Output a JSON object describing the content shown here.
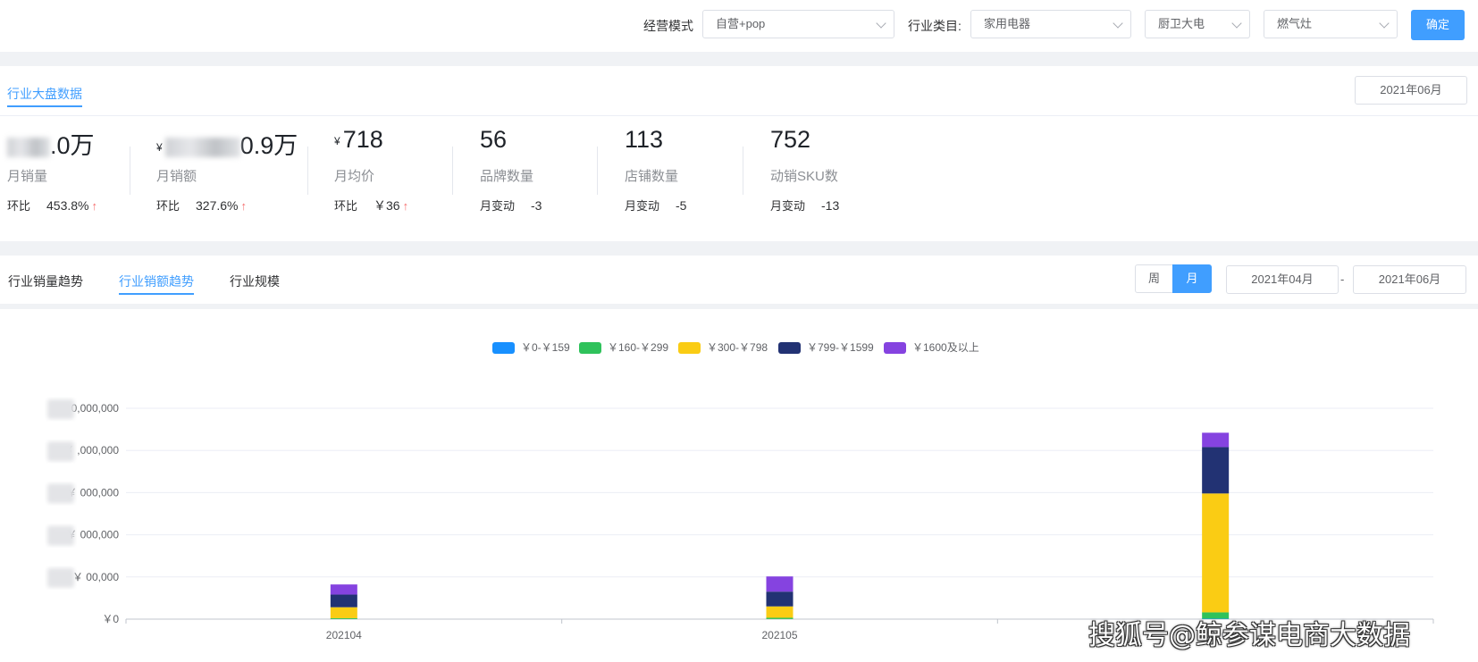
{
  "filters": {
    "mode_label": "经营模式",
    "mode_value": "自营+pop",
    "category_label": "行业类目:",
    "category_value": "家用电器",
    "subcategory_value": "厨卫大电",
    "subsubcategory_value": "燃气灶",
    "confirm_label": "确定"
  },
  "overview": {
    "tab_label": "行业大盘数据",
    "date": "2021年06月",
    "stats": [
      {
        "value": ".0万",
        "label": "月销量",
        "sub_label": "环比",
        "sub_value": "453.8%",
        "trend": "up"
      },
      {
        "yen": "¥",
        "value": "0.9万",
        "label": "月销额",
        "sub_label": "环比",
        "sub_value": "327.6%",
        "trend": "up"
      },
      {
        "yen": "¥",
        "value": "718",
        "label": "月均价",
        "sub_label": "环比",
        "sub_value": "￥36",
        "trend": "up"
      },
      {
        "value": "56",
        "label": "品牌数量",
        "sub_label": "月变动",
        "sub_value": "-3"
      },
      {
        "value": "113",
        "label": "店铺数量",
        "sub_label": "月变动",
        "sub_value": "-5"
      },
      {
        "value": "752",
        "label": "动销SKU数",
        "sub_label": "月变动",
        "sub_value": "-13"
      }
    ],
    "up_arrow": "↑"
  },
  "trend_tabs": {
    "tabs": [
      "行业销量趋势",
      "行业销额趋势",
      "行业规模"
    ],
    "active_index": 1,
    "period_week": "周",
    "period_month": "月",
    "period_active": "月",
    "start_date": "2021年04月",
    "date_sep": "-",
    "end_date": "2021年06月"
  },
  "chart_data": {
    "type": "bar",
    "stacked": true,
    "categories": [
      "202104",
      "202105",
      "202106"
    ],
    "series": [
      {
        "name": "￥0-￥159",
        "color": "#1890ff",
        "values": [
          0.2,
          0.2,
          1
        ]
      },
      {
        "name": "￥160-￥299",
        "color": "#2fc25b",
        "values": [
          2,
          3,
          15
        ]
      },
      {
        "name": "￥300-￥798",
        "color": "#facc14",
        "values": [
          26,
          27,
          282
        ]
      },
      {
        "name": "￥799-￥1599",
        "color": "#223273",
        "values": [
          30,
          35,
          110
        ]
      },
      {
        "name": "￥1600及以上",
        "color": "#8543e0",
        "values": [
          24,
          36,
          34
        ]
      }
    ],
    "ylim": [
      0,
      500
    ],
    "y_ticks": [
      0,
      100,
      200,
      300,
      400,
      500
    ],
    "y_tick_labels": [
      "￥0",
      "￥ 00,000",
      "￥ 000,000",
      "￥ 000,000",
      "￥ ,000,000",
      "￥ 0,000,000"
    ],
    "y_tick_obscured": [
      false,
      true,
      true,
      true,
      true,
      true
    ],
    "grid": true,
    "legend": "top-center"
  },
  "watermark": "搜狐号@鲸参谋电商大数据"
}
